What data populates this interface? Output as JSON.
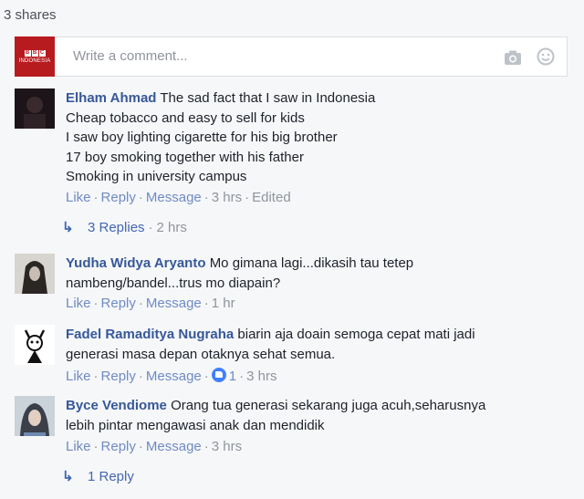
{
  "shares": "3 shares",
  "compose": {
    "placeholder": "Write a comment...",
    "page_avatar_top": "BBC",
    "page_avatar_sub": "INDONESIA",
    "camera_icon": "camera-icon",
    "emoji_icon": "smile-icon"
  },
  "comments": [
    {
      "author": "Elham Ahmad",
      "lines": [
        "The sad fact that I saw in Indonesia",
        "Cheap tobacco and easy to sell for kids",
        "I saw boy lighting cigarette for his big brother",
        "17 boy smoking together with his father",
        "Smoking in university campus"
      ],
      "like": "Like",
      "reply": "Reply",
      "message": "Message",
      "time": "3 hrs",
      "edited": "Edited",
      "replies_label": "3 Replies",
      "replies_time": "2 hrs"
    },
    {
      "author": "Yudha Widya Aryanto",
      "lines": [
        "Mo gimana lagi...dikasih tau tetep",
        "nambeng/bandel...trus mo diapain?"
      ],
      "like": "Like",
      "reply": "Reply",
      "message": "Message",
      "time": "1 hr"
    },
    {
      "author": "Fadel Ramaditya Nugraha",
      "lines": [
        "biarin aja doain semoga cepat mati jadi",
        "generasi masa depan otaknya sehat semua."
      ],
      "like": "Like",
      "reply": "Reply",
      "message": "Message",
      "reaction_count": "1",
      "time": "3 hrs"
    },
    {
      "author": "Byce Vendiome",
      "lines": [
        "Orang tua generasi sekarang juga acuh,seharusnya",
        "lebih pintar mengawasi anak dan mendidik"
      ],
      "like": "Like",
      "reply": "Reply",
      "message": "Message",
      "time": "3 hrs",
      "replies_label": "1 Reply"
    }
  ]
}
